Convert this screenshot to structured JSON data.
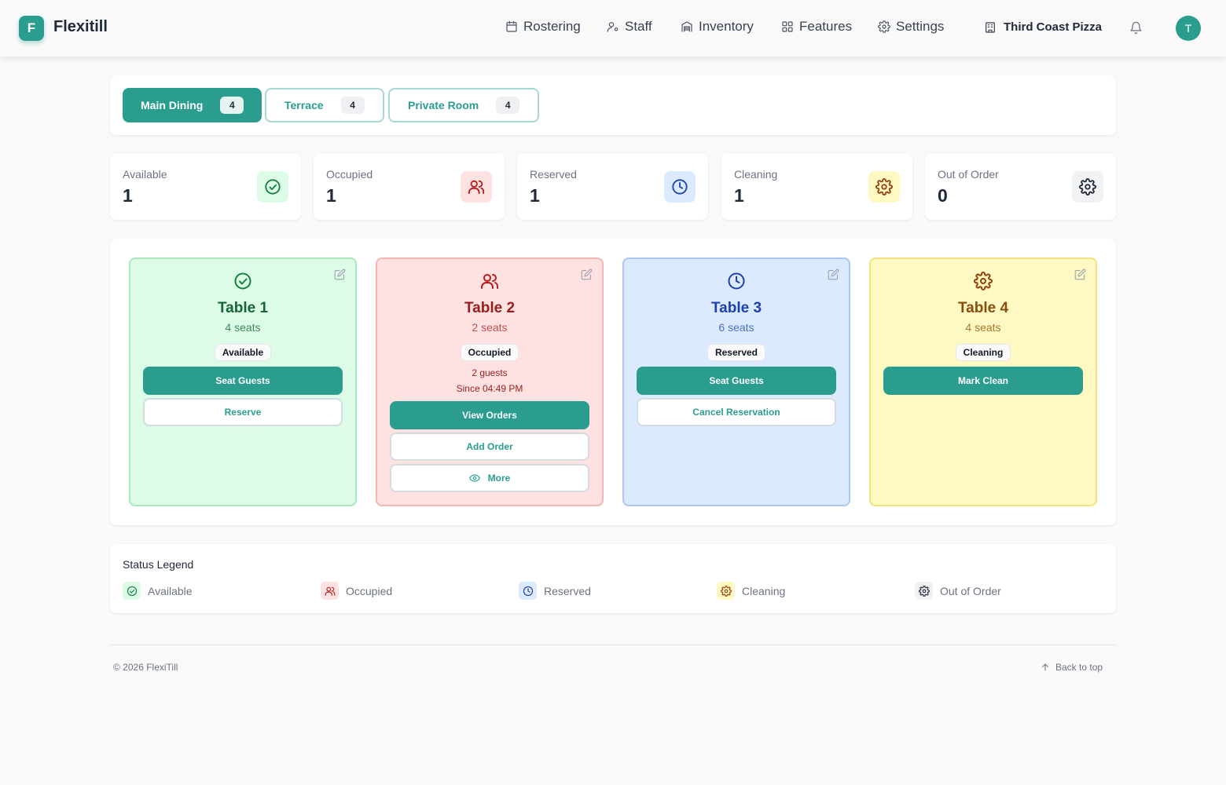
{
  "header": {
    "logo_letter": "F",
    "app_name": "Flexitill",
    "nav": [
      {
        "label": "Rostering",
        "icon": "calendar-icon"
      },
      {
        "label": "Staff",
        "icon": "user-cog-icon"
      },
      {
        "label": "Inventory",
        "icon": "warehouse-icon"
      },
      {
        "label": "Features",
        "icon": "grid-icon"
      },
      {
        "label": "Settings",
        "icon": "gear-icon"
      }
    ],
    "restaurant": "Third Coast Pizza",
    "avatar_letter": "T"
  },
  "areas": [
    {
      "label": "Main Dining",
      "count": "4",
      "active": true
    },
    {
      "label": "Terrace",
      "count": "4",
      "active": false
    },
    {
      "label": "Private Room",
      "count": "4",
      "active": false
    }
  ],
  "stats": [
    {
      "label": "Available",
      "value": "1",
      "icon": "check-circle-icon"
    },
    {
      "label": "Occupied",
      "value": "1",
      "icon": "users-icon"
    },
    {
      "label": "Reserved",
      "value": "1",
      "icon": "clock-icon"
    },
    {
      "label": "Cleaning",
      "value": "1",
      "icon": "gear-icon"
    },
    {
      "label": "Out of Order",
      "value": "0",
      "icon": "gear-icon"
    }
  ],
  "tables": [
    {
      "name": "Table 1",
      "seats": "4 seats",
      "status": "Available",
      "primary": "Seat Guests",
      "secondary": "Reserve"
    },
    {
      "name": "Table 2",
      "seats": "2 seats",
      "status": "Occupied",
      "guests": "2 guests",
      "since": "Since 04:49 PM",
      "primary": "View Orders",
      "secondary": "Add Order",
      "more": "More"
    },
    {
      "name": "Table 3",
      "seats": "6 seats",
      "status": "Reserved",
      "primary": "Seat Guests",
      "secondary": "Cancel Reservation"
    },
    {
      "name": "Table 4",
      "seats": "4 seats",
      "status": "Cleaning",
      "primary": "Mark Clean"
    }
  ],
  "legend": {
    "title": "Status Legend",
    "items": [
      "Available",
      "Occupied",
      "Reserved",
      "Cleaning",
      "Out of Order"
    ]
  },
  "colors": {
    "accent": "#2a9d8f",
    "available": "#15803d",
    "occupied": "#b91c1c",
    "reserved": "#1e40af",
    "cleaning": "#92400e",
    "out_of_order": "#1f2937"
  },
  "footer": {
    "copyright": "© 2026 FlexiTill",
    "back_to_top": "Back to top"
  }
}
